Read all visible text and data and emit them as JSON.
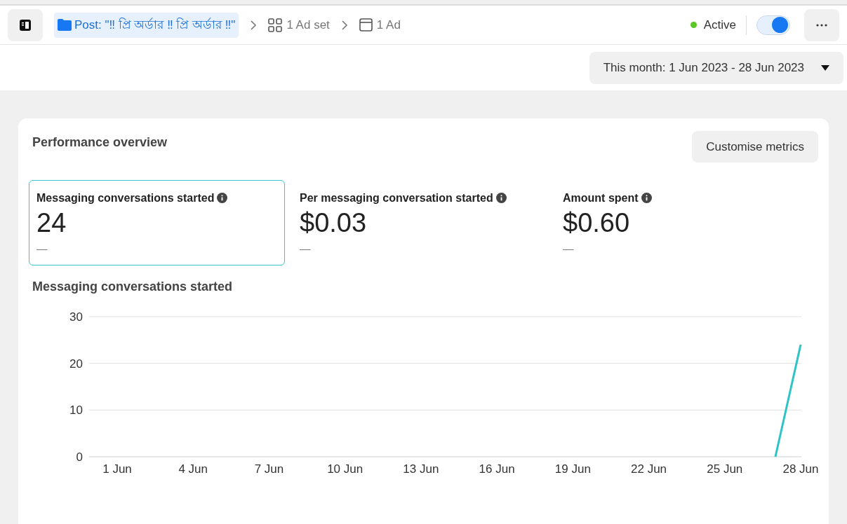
{
  "breadcrumb": {
    "post": "Post: \"‼ প্রি অর্ডার ‼ প্রি অর্ডার ‼\"",
    "ad_set": "1 Ad set",
    "ad": "1 Ad"
  },
  "status": {
    "label": "Active",
    "color": "#5ac725",
    "on": true
  },
  "date_range": "This month: 1 Jun 2023 - 28 Jun 2023",
  "card": {
    "title": "Performance overview",
    "customise_button": "Customise metrics",
    "metrics": [
      {
        "label": "Messaging conversations started",
        "value": "24",
        "change": "––",
        "selected": true
      },
      {
        "label": "Per messaging conversation started",
        "value": "$0.03",
        "change": "––",
        "selected": false
      },
      {
        "label": "Amount spent",
        "value": "$0.60",
        "change": "––",
        "selected": false
      }
    ],
    "chart_title": "Messaging conversations started",
    "chart_data": {
      "type": "line",
      "categories": [
        "1 Jun",
        null,
        null,
        "4 Jun",
        null,
        null,
        "7 Jun",
        null,
        null,
        "10 Jun",
        null,
        null,
        "13 Jun",
        null,
        null,
        "16 Jun",
        null,
        null,
        "19 Jun",
        null,
        null,
        "22 Jun",
        null,
        null,
        "25 Jun",
        null,
        null,
        "28 Jun"
      ],
      "series": [
        {
          "color": "#2ec4c6",
          "values": [
            null,
            null,
            null,
            null,
            null,
            null,
            null,
            null,
            null,
            null,
            null,
            null,
            null,
            null,
            null,
            null,
            null,
            null,
            null,
            null,
            null,
            null,
            null,
            null,
            null,
            null,
            0,
            24
          ]
        }
      ],
      "ylim": [
        0,
        30
      ],
      "yticks": [
        0,
        10,
        20,
        30
      ]
    }
  }
}
